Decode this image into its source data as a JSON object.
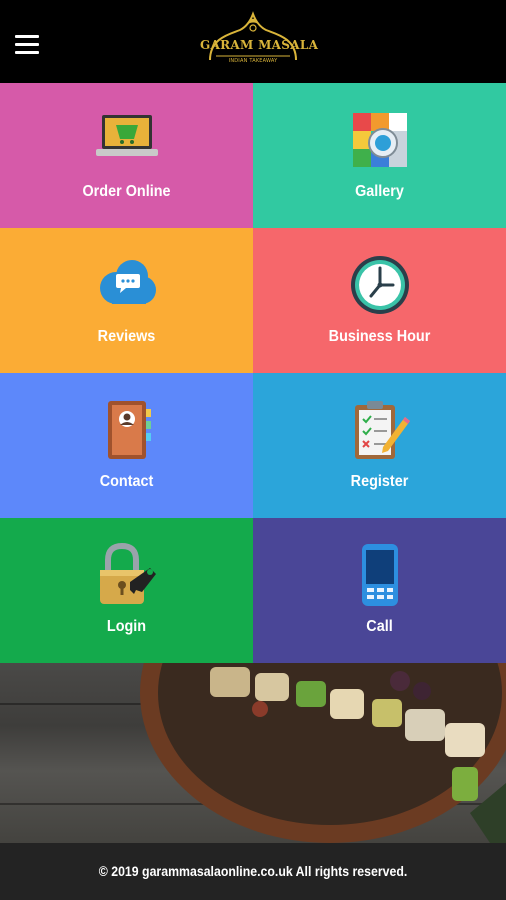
{
  "header": {
    "menu_icon": "hamburger-menu-icon",
    "logo_title": "GARAM MASALA",
    "logo_subtitle": "INDIAN TAKEAWAY"
  },
  "tiles": [
    {
      "label": "Order Online",
      "icon": "laptop-cart-icon",
      "color": "#d65aa9"
    },
    {
      "label": "Gallery",
      "icon": "gallery-icon",
      "color": "#31c9a1"
    },
    {
      "label": "Reviews",
      "icon": "chat-cloud-icon",
      "color": "#fbac35"
    },
    {
      "label": "Business Hour",
      "icon": "clock-icon",
      "color": "#f6676b"
    },
    {
      "label": "Contact",
      "icon": "address-book-icon",
      "color": "#5d88fa"
    },
    {
      "label": "Register",
      "icon": "clipboard-pencil-icon",
      "color": "#2ba5da"
    },
    {
      "label": "Login",
      "icon": "padlock-key-icon",
      "color": "#14aa4c"
    },
    {
      "label": "Call",
      "icon": "phone-icon",
      "color": "#4a4697"
    }
  ],
  "footer": {
    "text": "© 2019 garammasalaonline.co.uk All rights reserved."
  }
}
